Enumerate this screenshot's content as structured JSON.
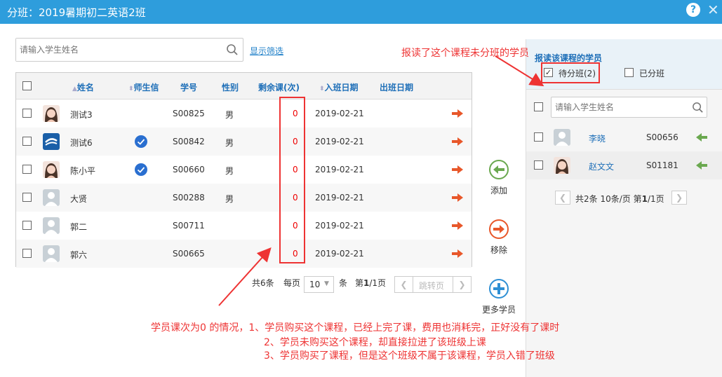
{
  "window": {
    "title": "分班：2019暑期初二英语2班",
    "help": "?",
    "close": "✕"
  },
  "search": {
    "placeholder": "请输入学生姓名"
  },
  "filter_link": "显示筛选",
  "table": {
    "headers": {
      "name": "姓名",
      "teacher": "师生信",
      "id": "学号",
      "gender": "性别",
      "remaining": "剩余课(次)",
      "enter": "入班日期",
      "leave": "出班日期"
    },
    "rows": [
      {
        "name": "测试3",
        "verified": false,
        "id": "S00825",
        "gender": "男",
        "remaining": "0",
        "enter": "2019-02-21",
        "avatar": "photo-girl"
      },
      {
        "name": "测试6",
        "verified": true,
        "id": "S00842",
        "gender": "男",
        "remaining": "0",
        "enter": "2019-02-21",
        "avatar": "logo"
      },
      {
        "name": "陈小平",
        "verified": true,
        "id": "S00660",
        "gender": "男",
        "remaining": "0",
        "enter": "2019-02-21",
        "avatar": "photo-girl2"
      },
      {
        "name": "大贤",
        "verified": false,
        "id": "S00288",
        "gender": "男",
        "remaining": "0",
        "enter": "2019-02-21",
        "avatar": "default"
      },
      {
        "name": "郭二",
        "verified": false,
        "id": "S00711",
        "gender": "",
        "remaining": "0",
        "enter": "2019-02-21",
        "avatar": "default"
      },
      {
        "name": "郭六",
        "verified": false,
        "id": "S00665",
        "gender": "",
        "remaining": "0",
        "enter": "2019-02-21",
        "avatar": "default"
      }
    ]
  },
  "pager": {
    "total": "共6条",
    "per_page_label": "每页",
    "per_page": "10",
    "unit": "条",
    "page_prefix": "第",
    "page_current": "1",
    "page_suffix": "/1页",
    "jump": "跳转页"
  },
  "actions": {
    "add": "添加",
    "remove": "移除",
    "more": "更多学员"
  },
  "right": {
    "title": "报读该课程的学员",
    "tab_pending": "待分班(2)",
    "tab_done": "已分班",
    "search_placeholder": "请输入学生姓名",
    "rows": [
      {
        "name": "李晓",
        "id": "S00656",
        "avatar": "default"
      },
      {
        "name": "赵文文",
        "id": "S01181",
        "avatar": "photo-girl3"
      }
    ],
    "pager": {
      "total": "共2条",
      "per_page": "10条/页",
      "page_prefix": "第",
      "page_current": "1",
      "page_suffix": "/1页"
    }
  },
  "annotations": {
    "top": "报读了这个课程未分班的学员",
    "line1": "学员课次为0 的情况，1、学员购买这个课程，已经上完了课，费用也消耗完，正好没有了课时",
    "line2": "2、学员未购买这个课程，却直接拉进了该班级上课",
    "line3": "3、学员购买了课程，但是这个班级不属于该课程，学员入错了班级"
  },
  "colors": {
    "titlebar": "#2e9ddc",
    "link": "#1e7fc8",
    "header_text": "#1e6fb8",
    "annotation": "#e33333",
    "arrow_orange": "#e8572a",
    "arrow_green": "#6aa84f"
  }
}
